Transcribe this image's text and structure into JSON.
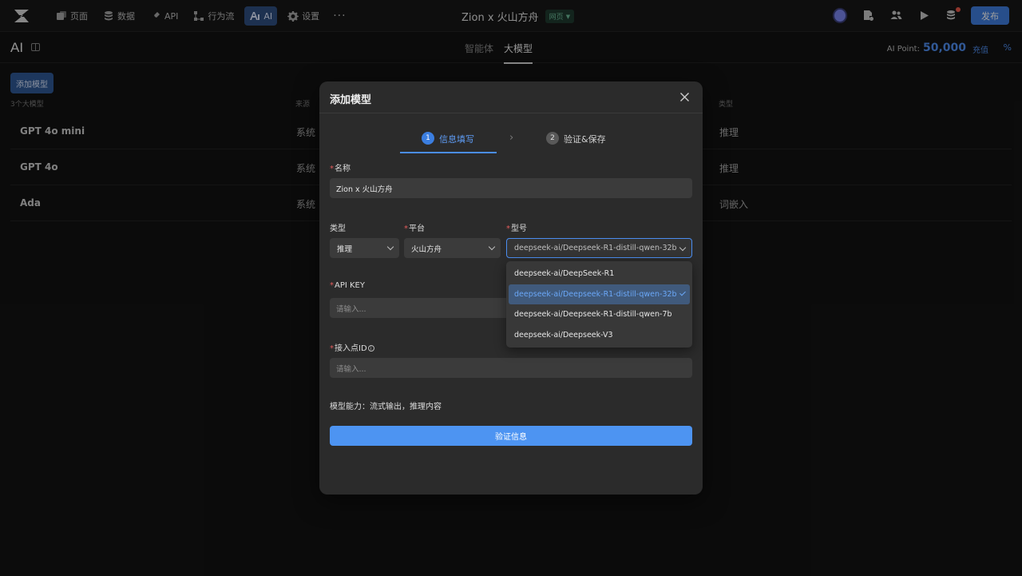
{
  "project": {
    "name": "Zion x 火山方舟",
    "badge": "网页"
  },
  "nav": {
    "items": [
      {
        "label": "页面",
        "icon": "page-icon"
      },
      {
        "label": "数据",
        "icon": "database-icon"
      },
      {
        "label": "API",
        "icon": "api-icon"
      },
      {
        "label": "行为流",
        "icon": "flow-icon"
      },
      {
        "label": "AI",
        "icon": "ai-icon",
        "active": true
      },
      {
        "label": "设置",
        "icon": "gear-icon"
      }
    ],
    "more": "···",
    "publish": "发布"
  },
  "subheader": {
    "title": "AI",
    "tabs": [
      {
        "label": "智能体"
      },
      {
        "label": "大模型",
        "active": true
      }
    ],
    "points_label": "AI Point:",
    "points_value": "50,000",
    "recharge": "充值",
    "percent_icon": "%"
  },
  "table": {
    "add_button": "添加模型",
    "count": "3个大模型",
    "col_source": "来源",
    "col_type": "类型",
    "rows": [
      {
        "name": "GPT 4o mini",
        "source": "系统",
        "type": "推理"
      },
      {
        "name": "GPT 4o",
        "source": "系统",
        "type": "推理"
      },
      {
        "name": "Ada",
        "source": "系统",
        "type": "词嵌入"
      }
    ]
  },
  "modal": {
    "title": "添加模型",
    "steps": [
      {
        "num": "1",
        "label": "信息填写"
      },
      {
        "num": "2",
        "label": "验证&保存"
      }
    ],
    "required_mark": "*",
    "name_label": "名称",
    "name_value": "Zion x 火山方舟",
    "type_label": "类型",
    "type_value": "推理",
    "platform_label": "平台",
    "platform_value": "火山方舟",
    "model_label": "型号",
    "model_value": "deepseek-ai/Deepseek-R1-distill-qwen-32b",
    "model_options": [
      "deepseek-ai/DeepSeek-R1",
      "deepseek-ai/Deepseek-R1-distill-qwen-32b",
      "deepseek-ai/Deepseek-R1-distill-qwen-7b",
      "deepseek-ai/Deepseek-V3"
    ],
    "api_key_label": "API KEY",
    "api_key_placeholder": "请输入...",
    "endpoint_label": "接入点ID",
    "endpoint_placeholder": "请输入...",
    "capability": "模型能力：流式输出，推理内容",
    "verify_button": "验证信息"
  }
}
